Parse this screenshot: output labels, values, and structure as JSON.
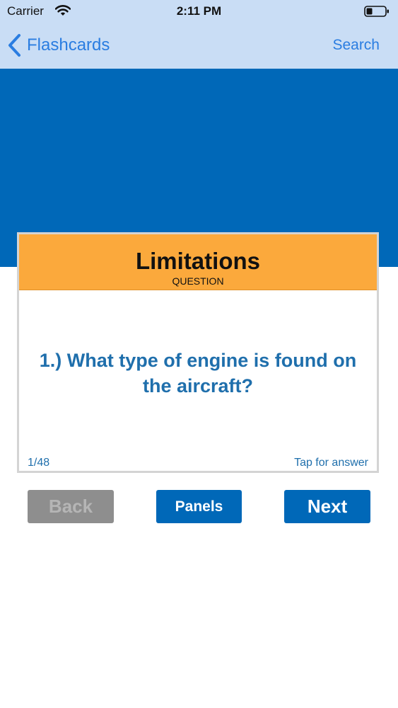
{
  "status_bar": {
    "carrier": "Carrier",
    "time": "2:11 PM",
    "wifi_icon": "wifi-icon",
    "battery_icon": "battery-icon"
  },
  "nav": {
    "back_label": "Flashcards",
    "search_label": "Search",
    "back_icon": "chevron-left-icon"
  },
  "card": {
    "title": "Limitations",
    "subtitle": "QUESTION",
    "question": "1.) What type of engine is found on the aircraft?",
    "counter": "1/48",
    "tap_hint": "Tap for answer"
  },
  "buttons": {
    "back": "Back",
    "panels": "Panels",
    "next": "Next"
  },
  "colors": {
    "topbar": "#c9ddf5",
    "brand_blue": "#0068b8",
    "card_header": "#fba93c",
    "link_blue": "#2a7de1",
    "question_text": "#1f6fac",
    "disabled_button": "#8e8e8e"
  }
}
